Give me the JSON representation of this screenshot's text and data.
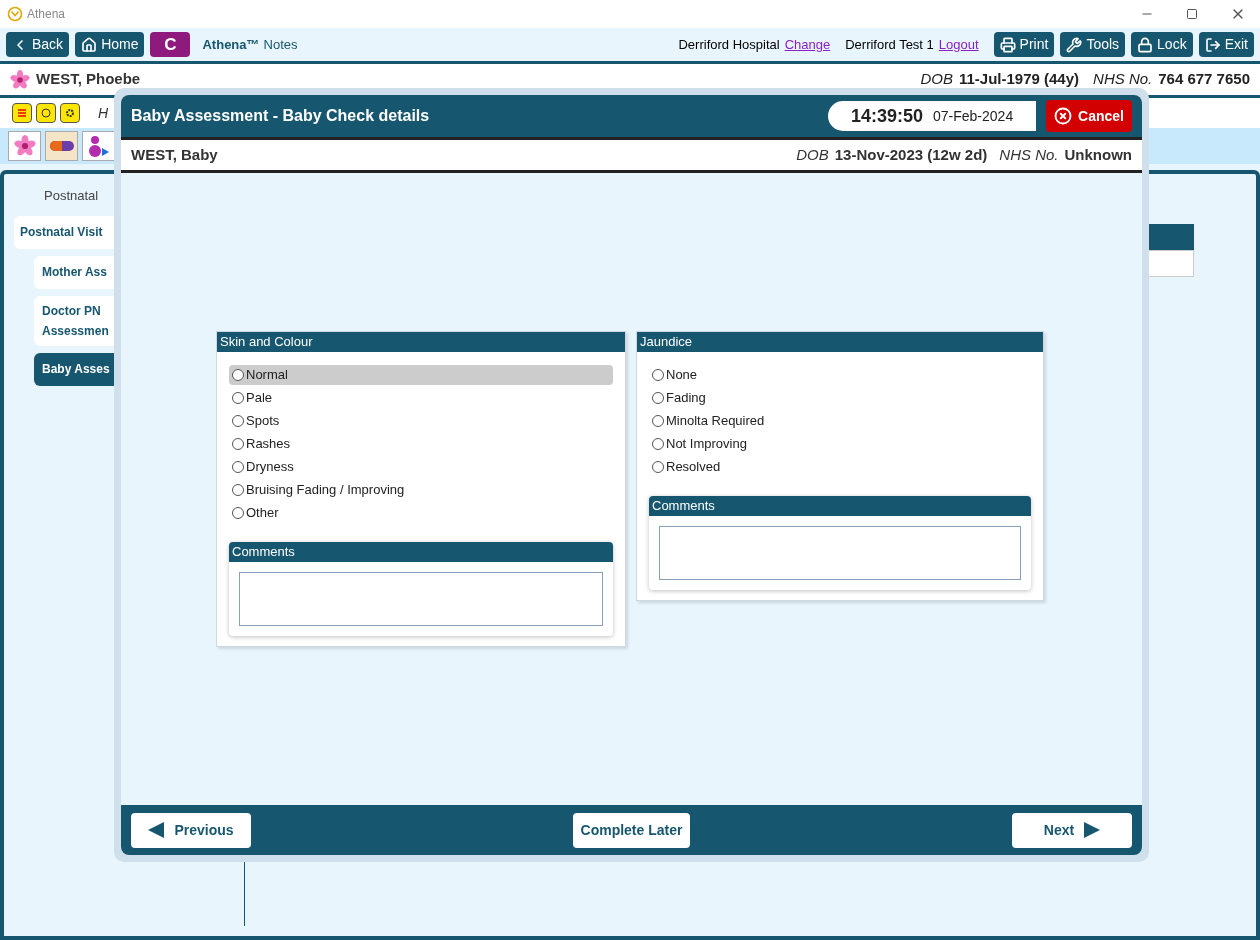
{
  "window": {
    "title": "Athena"
  },
  "toolbar": {
    "left_buttons": [
      {
        "kind": "back",
        "label": "Back"
      },
      {
        "kind": "home",
        "label": "Home"
      },
      {
        "kind": "letter",
        "label": "C"
      }
    ],
    "app_name": "Athena™",
    "app_suffix": "Notes",
    "site": "Derriford Hospital",
    "site_link": "Change",
    "user": "Derriford Test 1",
    "user_link": "Logout",
    "right_buttons": [
      {
        "kind": "print",
        "label": "Print"
      },
      {
        "kind": "tools",
        "label": "Tools"
      },
      {
        "kind": "lock",
        "label": "Lock"
      },
      {
        "kind": "exit",
        "label": "Exit"
      }
    ]
  },
  "patient": {
    "name": "WEST, Phoebe",
    "dob_label": "DOB",
    "dob": "11-Jul-1979 (44y)",
    "nhs_label": "NHS No.",
    "nhs": "764 677 7650"
  },
  "alerts_row": {
    "text": "H"
  },
  "sidebar": {
    "heading": "Postnatal",
    "items": [
      {
        "label": "Postnatal Visit",
        "selected": false,
        "children": [
          {
            "label": "Mother Ass",
            "selected": false
          },
          {
            "label": "Doctor PN\nAssessmen",
            "selected": false
          },
          {
            "label": "Baby Asses",
            "selected": true
          }
        ]
      }
    ]
  },
  "dialog": {
    "title": "Baby Assessment - Baby Check details",
    "time": "14:39:50",
    "date": "07-Feb-2024",
    "cancel": "Cancel",
    "baby": {
      "name": "WEST, Baby",
      "dob_label": "DOB",
      "dob": "13-Nov-2023 (12w 2d)",
      "nhs_label": "NHS No.",
      "nhs": "Unknown"
    },
    "panels": [
      {
        "title": "Skin and Colour",
        "options": [
          {
            "label": "Normal",
            "selected": false,
            "highlighted": true
          },
          {
            "label": "Pale",
            "selected": false,
            "highlighted": false
          },
          {
            "label": "Spots",
            "selected": false,
            "highlighted": false
          },
          {
            "label": "Rashes",
            "selected": false,
            "highlighted": false
          },
          {
            "label": "Dryness",
            "selected": false,
            "highlighted": false
          },
          {
            "label": "Bruising Fading / Improving",
            "selected": false,
            "highlighted": false
          },
          {
            "label": "Other",
            "selected": false,
            "highlighted": false
          }
        ],
        "comments": {
          "title": "Comments"
        }
      },
      {
        "title": "Jaundice",
        "options": [
          {
            "label": "None",
            "selected": false,
            "highlighted": false
          },
          {
            "label": "Fading",
            "selected": false,
            "highlighted": false
          },
          {
            "label": "Minolta Required",
            "selected": false,
            "highlighted": false
          },
          {
            "label": "Not Improving",
            "selected": false,
            "highlighted": false
          },
          {
            "label": "Resolved",
            "selected": false,
            "highlighted": false
          }
        ],
        "comments": {
          "title": "Comments"
        }
      }
    ],
    "footer": {
      "previous": "Previous",
      "complete_later": "Complete Later",
      "next": "Next"
    }
  }
}
